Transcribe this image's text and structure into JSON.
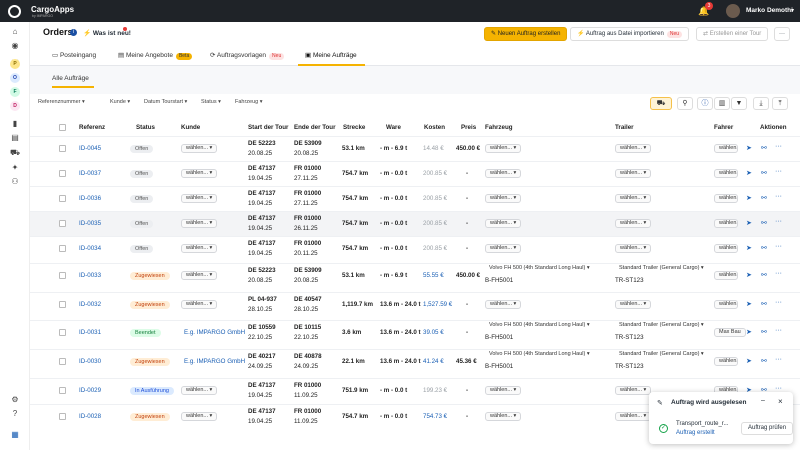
{
  "topbar": {
    "brand": "CargoApps",
    "sub": "by IMPARGO",
    "notif_count": "3",
    "user": "Marko Demothi"
  },
  "header": {
    "title": "Orders",
    "whats_new": "Was ist neu!",
    "new_order": "Neuen Auftrag erstellen",
    "import": "Auftrag aus Datei importieren",
    "import_badge": "Neu",
    "create_tour": "Erstellen einer Tour",
    "more": "···"
  },
  "tabs": [
    {
      "label": "Posteingang"
    },
    {
      "label": "Meine Angebote",
      "badge": "Beta"
    },
    {
      "label": "Auftragsvorlagen",
      "badge": "Neu"
    },
    {
      "label": "Meine Aufträge"
    }
  ],
  "subtab": "Alle Aufträge",
  "filters": [
    "Referenznummer",
    "Kunde",
    "Datum Tourstart",
    "Status",
    "Fahrzeug"
  ],
  "columns": [
    "Referenz",
    "Status",
    "Kunde",
    "Start der Tour",
    "Ende der Tour",
    "Strecke",
    "Ware",
    "Kosten",
    "Preis",
    "Fahrzeug",
    "Trailer",
    "Fahrer",
    "Aktionen"
  ],
  "placeholder_select": "wählen...",
  "rows": [
    {
      "ref": "ID-0045",
      "status": "Offen",
      "status_kind": "open",
      "kunde": "",
      "start_place": "DE 52223",
      "start_date": "20.08.25",
      "end_place": "DE 53909",
      "end_date": "20.08.25",
      "strecke": "53.1 km",
      "ware": "- m - 6.9 t",
      "kosten": "14.48 €",
      "kosten_kind": "gray",
      "preis": "450.00 €",
      "fz": "",
      "fz_plate": "",
      "tr": "",
      "tr_plate": "",
      "fahrer": ""
    },
    {
      "ref": "ID-0037",
      "status": "Offen",
      "status_kind": "open",
      "kunde": "",
      "start_place": "DE 47137",
      "start_date": "19.04.25",
      "end_place": "FR 01000",
      "end_date": "27.11.25",
      "strecke": "754.7 km",
      "ware": "- m - 0.0 t",
      "kosten": "200.85 €",
      "kosten_kind": "gray",
      "preis": "-",
      "fz": "",
      "fz_plate": "",
      "tr": "",
      "tr_plate": "",
      "fahrer": ""
    },
    {
      "ref": "ID-0036",
      "status": "Offen",
      "status_kind": "open",
      "kunde": "",
      "start_place": "DE 47137",
      "start_date": "19.04.25",
      "end_place": "FR 01000",
      "end_date": "27.11.25",
      "strecke": "754.7 km",
      "ware": "- m - 0.0 t",
      "kosten": "200.85 €",
      "kosten_kind": "gray",
      "preis": "-",
      "fz": "",
      "fz_plate": "",
      "tr": "",
      "tr_plate": "",
      "fahrer": ""
    },
    {
      "ref": "ID-0035",
      "status": "Offen",
      "status_kind": "open",
      "kunde": "",
      "start_place": "DE 47137",
      "start_date": "19.04.25",
      "end_place": "FR 01000",
      "end_date": "26.11.25",
      "strecke": "754.7 km",
      "ware": "- m - 0.0 t",
      "kosten": "200.85 €",
      "kosten_kind": "gray",
      "preis": "-",
      "fz": "",
      "fz_plate": "",
      "tr": "",
      "tr_plate": "",
      "fahrer": "",
      "hover": true
    },
    {
      "ref": "ID-0034",
      "status": "Offen",
      "status_kind": "open",
      "kunde": "",
      "start_place": "DE 47137",
      "start_date": "19.04.25",
      "end_place": "FR 01000",
      "end_date": "20.11.25",
      "strecke": "754.7 km",
      "ware": "- m - 0.0 t",
      "kosten": "200.85 €",
      "kosten_kind": "gray",
      "preis": "-",
      "fz": "",
      "fz_plate": "",
      "tr": "",
      "tr_plate": "",
      "fahrer": ""
    },
    {
      "ref": "ID-0033",
      "status": "Zugewiesen",
      "status_kind": "assigned",
      "kunde": "",
      "start_place": "DE 52223",
      "start_date": "20.08.25",
      "end_place": "DE 53909",
      "end_date": "20.08.25",
      "strecke": "53.1 km",
      "ware": "- m - 6.9 t",
      "kosten": "55.55 €",
      "kosten_kind": "blue",
      "preis": "450.00 €",
      "fz": "Volvo FH 500 (4th Standard Long Haul)",
      "fz_plate": "B-FH5001",
      "tr": "Standard Trailer (General Cargo)",
      "tr_plate": "TR-ST123",
      "fahrer": ""
    },
    {
      "ref": "ID-0032",
      "status": "Zugewiesen",
      "status_kind": "assigned",
      "kunde": "",
      "start_place": "PL 04-937",
      "start_date": "28.10.25",
      "end_place": "DE 40547",
      "end_date": "28.10.25",
      "strecke": "1,119.7 km",
      "ware": "13.6 m - 24.0 t",
      "kosten": "1,527.59 €",
      "kosten_kind": "blue",
      "preis": "-",
      "fz": "",
      "fz_plate": "",
      "tr": "",
      "tr_plate": "",
      "fahrer": ""
    },
    {
      "ref": "ID-0031",
      "status": "Beendet",
      "status_kind": "done",
      "kunde": "E.g. IMPARGO GmbH",
      "start_place": "DE 10559",
      "start_date": "22.10.25",
      "end_place": "DE 10115",
      "end_date": "22.10.25",
      "strecke": "3.6 km",
      "ware": "13.6 m - 24.0 t",
      "kosten": "39.05 €",
      "kosten_kind": "blue",
      "preis": "-",
      "fz": "Volvo FH 500 (4th Standard Long Haul)",
      "fz_plate": "B-FH5001",
      "tr": "Standard Trailer (General Cargo)",
      "tr_plate": "TR-ST123",
      "fahrer": "Max Bau"
    },
    {
      "ref": "ID-0030",
      "status": "Zugewiesen",
      "status_kind": "assigned",
      "kunde": "E.g. IMPARGO GmbH",
      "start_place": "DE 40217",
      "start_date": "24.09.25",
      "end_place": "DE 40878",
      "end_date": "24.09.25",
      "strecke": "22.1 km",
      "ware": "13.6 m - 24.0 t",
      "kosten": "41.24 €",
      "kosten_kind": "blue",
      "preis": "45.36 €",
      "fz": "Volvo FH 500 (4th Standard Long Haul)",
      "fz_plate": "B-FH5001",
      "tr": "Standard Trailer (General Cargo)",
      "tr_plate": "TR-ST123",
      "fahrer": ""
    },
    {
      "ref": "ID-0029",
      "status": "In Ausführung",
      "status_kind": "progress",
      "kunde": "",
      "start_place": "DE 47137",
      "start_date": "19.04.25",
      "end_place": "FR 01000",
      "end_date": "11.09.25",
      "strecke": "751.9 km",
      "ware": "- m - 0.0 t",
      "kosten": "199.23 €",
      "kosten_kind": "gray",
      "preis": "-",
      "fz": "",
      "fz_plate": "",
      "tr": "",
      "tr_plate": "",
      "fahrer": ""
    },
    {
      "ref": "ID-0028",
      "status": "Zugewiesen",
      "status_kind": "assigned",
      "kunde": "",
      "start_place": "DE 47137",
      "start_date": "19.04.25",
      "end_place": "FR 01000",
      "end_date": "11.09.25",
      "strecke": "754.7 km",
      "ware": "- m - 0.0 t",
      "kosten": "754.73 €",
      "kosten_kind": "blue",
      "preis": "-",
      "fz": "",
      "fz_plate": "",
      "tr": "",
      "tr_plate": "",
      "fahrer": ""
    }
  ],
  "toast": {
    "title": "Auftrag wird ausgelesen",
    "file": "Transport_route_r...",
    "sub": "Auftrag erstellt",
    "button": "Auftrag prüfen",
    "minimize": "–",
    "close": "×"
  },
  "colors": {
    "accent": "#f5b301",
    "link": "#1a5fb4",
    "topbar": "#1f2328"
  },
  "icons": {
    "sidebar": [
      "home-icon",
      "globe-icon",
      "chart-icon",
      "bookmark-icon",
      "file-icon",
      "truck-icon",
      "handshake-icon",
      "users-icon",
      "settings-icon",
      "help-icon",
      "layout-icon"
    ]
  }
}
